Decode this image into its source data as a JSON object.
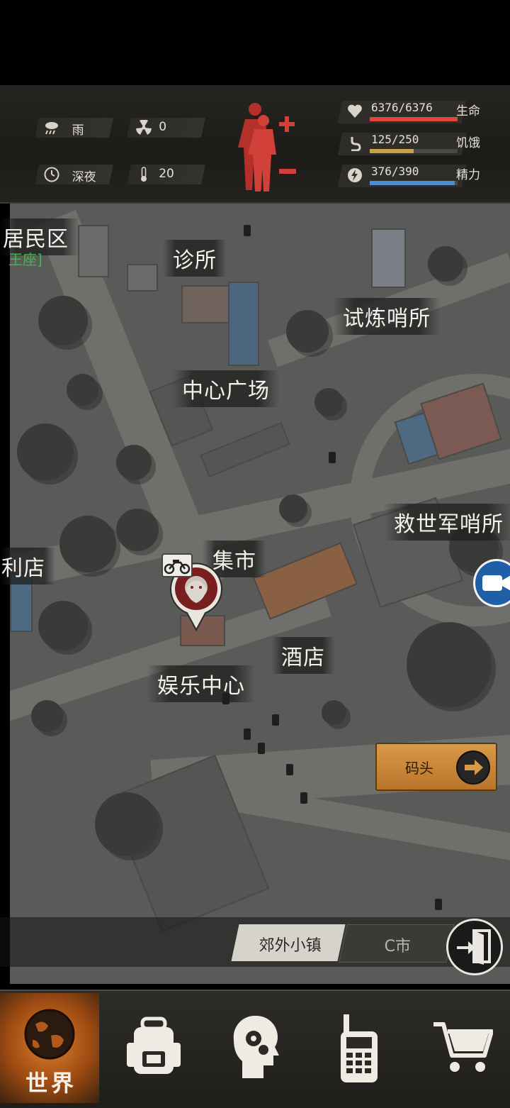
{
  "status": {
    "weather": "雨",
    "radiation": "0",
    "time_of_day": "深夜",
    "temperature": "20",
    "icons": [
      "rain-cloud-icon",
      "radiation-icon",
      "clock-icon",
      "thermometer-icon"
    ]
  },
  "vitals": {
    "health": {
      "value": "6376/6376",
      "label": "生命",
      "fraction": 1.0,
      "color": "#e3463a"
    },
    "hunger": {
      "value": "125/250",
      "label": "饥饿",
      "fraction": 0.5,
      "color": "#c9a14a"
    },
    "stamina": {
      "value": "376/390",
      "label": "精力",
      "fraction": 0.964,
      "color": "#4a8fd6"
    }
  },
  "map": {
    "locations": [
      {
        "id": "residential",
        "name": "居民区"
      },
      {
        "id": "clinic",
        "name": "诊所"
      },
      {
        "id": "trial-outpost",
        "name": "试炼哨所"
      },
      {
        "id": "central-square",
        "name": "中心广场"
      },
      {
        "id": "salvation-outpost",
        "name": "救世军哨所"
      },
      {
        "id": "convenience-store",
        "name": "利店"
      },
      {
        "id": "market",
        "name": "集市"
      },
      {
        "id": "hotel",
        "name": "酒店"
      },
      {
        "id": "entertainment-center",
        "name": "娱乐中心"
      }
    ],
    "residential_tag": "王座]",
    "dock_button": "码头"
  },
  "regions": {
    "active": "郊外小镇",
    "other": "C市"
  },
  "nav": {
    "world_label": "世界",
    "items": [
      "world-globe-icon",
      "backpack-icon",
      "skills-head-icon",
      "radio-icon",
      "shopping-cart-icon"
    ]
  },
  "colors": {
    "accent_orange": "#d99a48",
    "health_red": "#e3463a"
  }
}
